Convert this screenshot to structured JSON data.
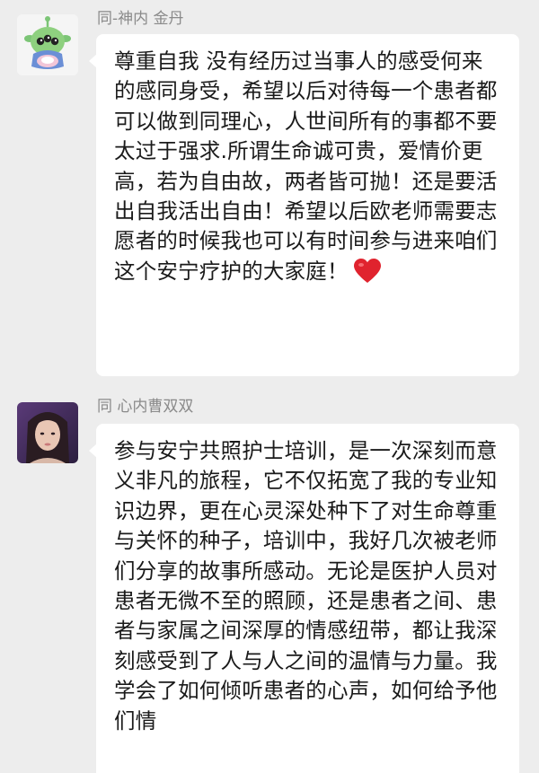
{
  "messages": [
    {
      "sender": "同-神内 金丹",
      "avatar_icon": "alien-toy-avatar-icon",
      "text": "尊重自我 没有经历过当事人的感受何来的感同身受，希望以后对待每一个患者都可以做到同理心，人世间所有的事都不要太过于强求.所谓生命诚可贵，爱情价更高，若为自由故，两者皆可抛！还是要活出自我活出自由！希望以后欧老师需要志愿者的时候我也可以有时间参与进来咱们这个安宁疗护的大家庭！",
      "emoji": "red-heart-icon"
    },
    {
      "sender": "同 心内曹双双",
      "avatar_icon": "user-photo-avatar-icon",
      "text": "参与安宁共照护士培训，是一次深刻而意义非凡的旅程，它不仅拓宽了我的专业知识边界，更在心灵深处种下了对生命尊重与关怀的种子，培训中，我好几次被老师们分享的故事所感动。无论是医护人员对患者无微不至的照顾，还是患者之间、患者与家属之间深厚的情感纽带，都让我深刻感受到了人与人之间的温情与力量。我学会了如何倾听患者的心声，如何给予他们情"
    }
  ],
  "colors": {
    "background": "#ededed",
    "bubble": "#ffffff",
    "sender_text": "#8a8a8a",
    "message_text": "#1a1a1a",
    "heart": "#e0232e"
  }
}
